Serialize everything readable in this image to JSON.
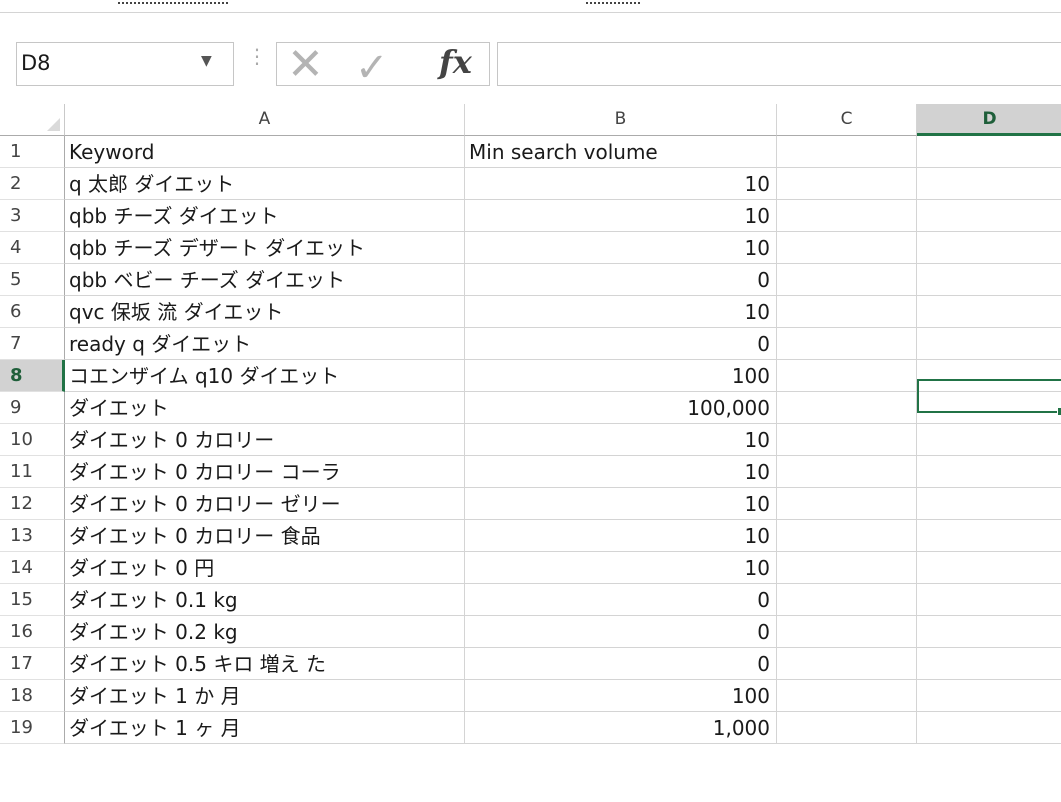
{
  "name_box": {
    "value": "D8"
  },
  "formula_bar": {
    "fx_label": "fx",
    "content": ""
  },
  "active_cell": {
    "column": "D",
    "row": "8"
  },
  "columns": [
    "A",
    "B",
    "C",
    "D"
  ],
  "rows": [
    {
      "num": "1",
      "A": "Keyword",
      "B": "Min search volume",
      "b_is_number": false
    },
    {
      "num": "2",
      "A": "q 太郎 ダイエット",
      "B": "10",
      "b_is_number": true
    },
    {
      "num": "3",
      "A": "qbb チーズ ダイエット",
      "B": "10",
      "b_is_number": true
    },
    {
      "num": "4",
      "A": "qbb チーズ デザート ダイエット",
      "B": "10",
      "b_is_number": true
    },
    {
      "num": "5",
      "A": "qbb ベビー チーズ ダイエット",
      "B": "0",
      "b_is_number": true
    },
    {
      "num": "6",
      "A": "qvc 保坂 流 ダイエット",
      "B": "10",
      "b_is_number": true
    },
    {
      "num": "7",
      "A": "ready q ダイエット",
      "B": "0",
      "b_is_number": true
    },
    {
      "num": "8",
      "A": "コエンザイム q10 ダイエット",
      "B": "100",
      "b_is_number": true
    },
    {
      "num": "9",
      "A": "ダイエット",
      "B": "100,000",
      "b_is_number": true
    },
    {
      "num": "10",
      "A": "ダイエット 0 カロリー",
      "B": "10",
      "b_is_number": true
    },
    {
      "num": "11",
      "A": "ダイエット 0 カロリー コーラ",
      "B": "10",
      "b_is_number": true
    },
    {
      "num": "12",
      "A": "ダイエット 0 カロリー ゼリー",
      "B": "10",
      "b_is_number": true
    },
    {
      "num": "13",
      "A": "ダイエット 0 カロリー 食品",
      "B": "10",
      "b_is_number": true
    },
    {
      "num": "14",
      "A": "ダイエット 0 円",
      "B": "10",
      "b_is_number": true
    },
    {
      "num": "15",
      "A": "ダイエット 0.1 kg",
      "B": "0",
      "b_is_number": true
    },
    {
      "num": "16",
      "A": "ダイエット 0.2 kg",
      "B": "0",
      "b_is_number": true
    },
    {
      "num": "17",
      "A": "ダイエット 0.5 キロ 増え た",
      "B": "0",
      "b_is_number": true
    },
    {
      "num": "18",
      "A": "ダイエット 1 か 月",
      "B": "100",
      "b_is_number": true
    },
    {
      "num": "19",
      "A": "ダイエット 1 ヶ 月",
      "B": "1,000",
      "b_is_number": true
    }
  ]
}
